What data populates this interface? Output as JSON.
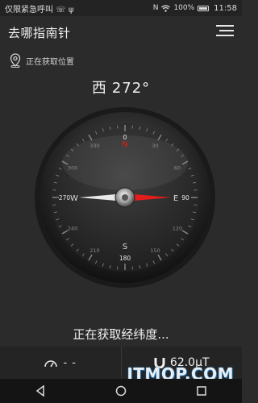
{
  "status_bar": {
    "left_text": "仅限紧急呼叫 ☏ ψ",
    "signal_text": "N",
    "battery_percent": "100%",
    "time": "11:58"
  },
  "app": {
    "title": "去哪指南针",
    "menu_icon": "menu-icon"
  },
  "location": {
    "icon": "location-pin-icon",
    "text": "正在获取位置"
  },
  "heading": {
    "direction": "西",
    "degrees": "272°",
    "angle_value": 272
  },
  "compass": {
    "cardinal": {
      "N": "N",
      "E": "E",
      "S": "S",
      "W": "W"
    },
    "degree_labels": [
      {
        "value": "0"
      },
      {
        "value": "30"
      },
      {
        "value": "60"
      },
      {
        "value": "90"
      },
      {
        "value": "120"
      },
      {
        "value": "150"
      },
      {
        "value": "180"
      },
      {
        "value": "210"
      },
      {
        "value": "240"
      },
      {
        "value": "270"
      },
      {
        "value": "300"
      },
      {
        "value": "330"
      }
    ],
    "colors": {
      "needle_red": "#e31c1c",
      "needle_white": "#e8e8e8",
      "bezel": "#1f1f1f",
      "face": "#2e2e2e",
      "ticks": "#8a8a8a"
    }
  },
  "status_text": "正在获取经纬度...",
  "bottom": {
    "speed_icon": "speedometer-icon",
    "speed_value": "- -",
    "magnet_icon": "magnet-icon",
    "magnet_value": "62.0μT"
  },
  "navbar": {
    "back_icon": "back-icon",
    "home_icon": "home-icon",
    "recents_icon": "recents-icon"
  },
  "watermark": "ITMOP.COM"
}
